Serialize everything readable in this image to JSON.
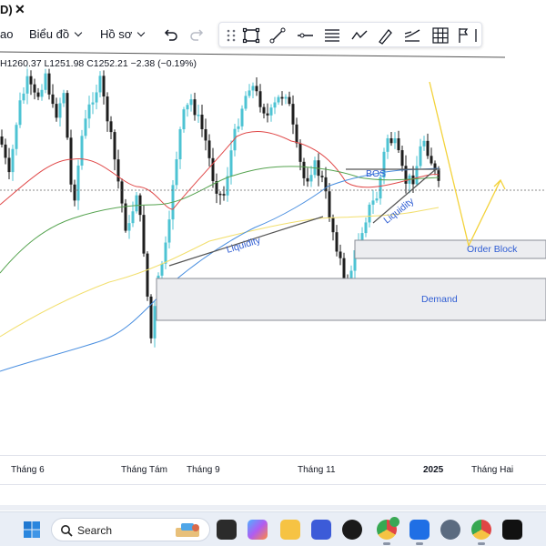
{
  "tab": {
    "title": "D)",
    "close_icon": "close-icon"
  },
  "toolbar": {
    "left_partial": "ao",
    "chart_menu": "Biểu đồ",
    "profile_menu": "Hồ sơ",
    "undo_icon": "undo-icon",
    "redo_icon": "redo-icon",
    "drawing_tools": [
      "drag-handle-icon",
      "rectangle-icon",
      "trend-line-icon",
      "horizontal-ray-icon",
      "fib-levels-icon",
      "path-icon",
      "brush-icon",
      "regression-icon",
      "grid-icon",
      "flag-icon",
      "more-icon"
    ]
  },
  "ohlc": {
    "text": "H1260.37  L1251.98  C1252.21  −2.38 (−0.19%)"
  },
  "annotations": {
    "bos": "BOS",
    "liquidity_left": "Liquidity",
    "liquidity_right": "Liquidity",
    "order_block": "Order Block",
    "demand": "Demand"
  },
  "time_axis": {
    "labels": [
      "Tháng 6",
      "Tháng Tám",
      "Tháng 9",
      "Tháng 11",
      "2025",
      "Tháng Hai"
    ]
  },
  "colors": {
    "up": "#4dc3d3",
    "down": "#1e1e1e",
    "ma_red": "#e04848",
    "ma_green": "#55a34f",
    "ma_yellow": "#f2df6e",
    "ma_blue": "#4a8fe0",
    "annotation_text": "#2f5dd3",
    "projection": "#f3d23a"
  },
  "taskbar": {
    "search_placeholder": "Search",
    "apps": [
      "start-icon",
      "copilot-widget-icon",
      "task-view-icon",
      "copilot-icon",
      "file-explorer-icon",
      "code-icon",
      "capcut-icon",
      "chrome-icon",
      "zalo-icon",
      "settings-icon",
      "chrome-profile-icon",
      "capcut-editor-icon"
    ]
  }
}
